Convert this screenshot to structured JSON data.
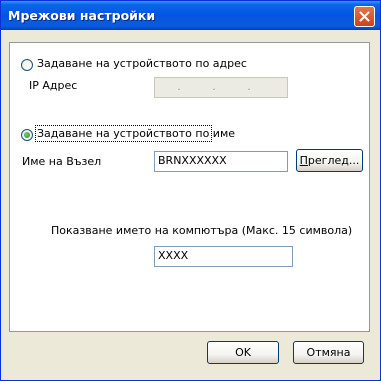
{
  "dialog": {
    "title": "Мрежови настройки"
  },
  "address_option": {
    "label": "Задаване на устройството по адрес",
    "selected": false
  },
  "ip_address": {
    "label": "IP Адрес",
    "value": ". . ."
  },
  "name_option": {
    "label": "Задаване на устройството по име",
    "selected": true
  },
  "node_name": {
    "label": "Име на Възел",
    "value": "BRNXXXXXX"
  },
  "browse_button": {
    "label_first": "П",
    "label_rest": "реглед..."
  },
  "computer_name": {
    "label": "Показване името на компютъра (Макс. 15 символа)",
    "value": "XXXX"
  },
  "footer": {
    "ok_label": "OK",
    "cancel_label": "Отмяна"
  }
}
